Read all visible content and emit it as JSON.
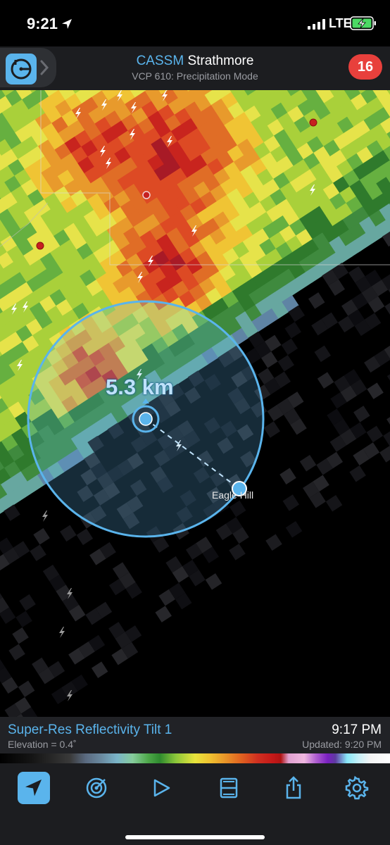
{
  "status_bar": {
    "time": "9:21",
    "network": "LTE",
    "icons": [
      "location-arrow-icon",
      "signal-bars-icon",
      "battery-charging-icon"
    ]
  },
  "header": {
    "station_id": "CASSM",
    "station_name": "Strathmore",
    "vcp": "VCP 610: Precipitation Mode",
    "alert_count": "16",
    "icons": [
      "radar-site-icon",
      "chevron-right-icon"
    ]
  },
  "map": {
    "distance_label": "5.3 km",
    "place_label": "Eagle Hill"
  },
  "info_bar": {
    "product": "Super-Res Reflectivity Tilt 1",
    "elevation": "Elevation = 0.4˚",
    "scan_time": "9:17 PM",
    "updated": "Updated: 9:20 PM"
  },
  "toolbar": {
    "items": [
      {
        "icon": "location-arrow-icon",
        "active": true
      },
      {
        "icon": "radar-sweep-icon",
        "active": false
      },
      {
        "icon": "play-icon",
        "active": false
      },
      {
        "icon": "layers-icon",
        "active": false
      },
      {
        "icon": "share-icon",
        "active": false
      },
      {
        "icon": "gear-icon",
        "active": false
      }
    ]
  },
  "colors": {
    "accent": "#5ab4ec",
    "alert": "#e8403c",
    "header_bg": "#1c1d20"
  }
}
